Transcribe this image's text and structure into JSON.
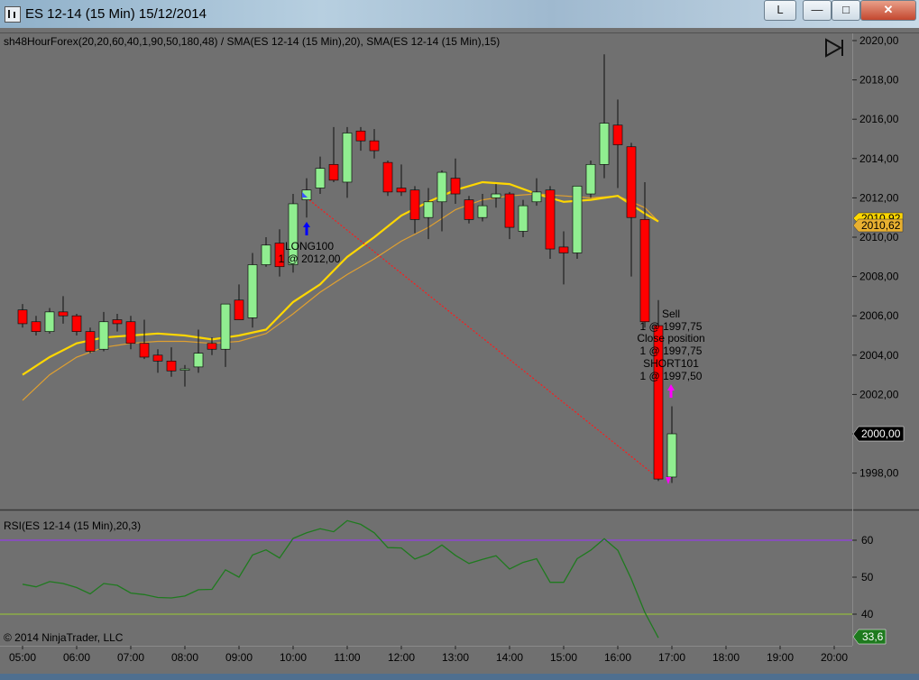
{
  "window": {
    "title": "ES 12-14 (15 Min)  15/12/2014",
    "buttons": {
      "account": "L",
      "minimize": "—",
      "maximize": "□",
      "close": "✕"
    }
  },
  "indicator_header": "sh48HourForex(20,20,60,40,1,90,50,180,48) / SMA(ES 12-14 (15 Min),20), SMA(ES 12-14 (15 Min),15)",
  "price_labels": {
    "current_price": "2000,00",
    "sma_a": "2010,92",
    "sma_b": "2010,62"
  },
  "annotations": {
    "long_entry": [
      "LONG100",
      "1 @ 2012,00"
    ],
    "short_exit": [
      "Sell",
      "1 @ 1997,75",
      "Close position",
      "1 @ 1997,75",
      "SHORT101",
      "1 @ 1997,50"
    ]
  },
  "rsi_header": "RSI(ES 12-14 (15 Min),20,3)",
  "rsi_current": "33,6",
  "copyright": "© 2014 NinjaTrader, LLC",
  "colors": {
    "panel": "#707070",
    "up_candle": "#90ee90",
    "down_candle": "#ff0000",
    "sma20": "#ffd700",
    "sma15": "#e0a030",
    "rsi_line": "#1f7a1f",
    "rsi_upper": "#9b30ff",
    "rsi_lower": "#9acd32"
  },
  "chart_data": {
    "type": "candlestick",
    "price_axis": {
      "ticks": [
        "2020,00",
        "2018,00",
        "2016,00",
        "2014,00",
        "2012,00",
        "2010,00",
        "2008,00",
        "2006,00",
        "2004,00",
        "2002,00",
        "2000,00",
        "1998,00"
      ],
      "range": [
        1996.5,
        2020.5
      ]
    },
    "rsi_axis": {
      "ticks": [
        "60",
        "50",
        "40"
      ],
      "range": [
        30,
        66
      ]
    },
    "time_axis": [
      "05:00",
      "06:00",
      "07:00",
      "08:00",
      "09:00",
      "10:00",
      "11:00",
      "12:00",
      "13:00",
      "14:00",
      "15:00",
      "16:00",
      "17:00",
      "18:00",
      "19:00",
      "20:00"
    ],
    "candles": [
      {
        "t": 5.0,
        "o": 2006.3,
        "h": 2006.6,
        "l": 2005.4,
        "c": 2005.6
      },
      {
        "t": 5.25,
        "o": 2005.7,
        "h": 2006.0,
        "l": 2005.0,
        "c": 2005.2
      },
      {
        "t": 5.5,
        "o": 2005.2,
        "h": 2006.4,
        "l": 2005.1,
        "c": 2006.2
      },
      {
        "t": 5.75,
        "o": 2006.2,
        "h": 2007.0,
        "l": 2005.6,
        "c": 2006.0
      },
      {
        "t": 6.0,
        "o": 2006.0,
        "h": 2006.1,
        "l": 2005.0,
        "c": 2005.2
      },
      {
        "t": 6.25,
        "o": 2005.2,
        "h": 2005.4,
        "l": 2004.1,
        "c": 2004.2
      },
      {
        "t": 6.5,
        "o": 2004.3,
        "h": 2006.2,
        "l": 2004.2,
        "c": 2005.7
      },
      {
        "t": 6.75,
        "o": 2005.8,
        "h": 2006.1,
        "l": 2005.2,
        "c": 2005.6
      },
      {
        "t": 7.0,
        "o": 2005.7,
        "h": 2006.0,
        "l": 2004.3,
        "c": 2004.6
      },
      {
        "t": 7.25,
        "o": 2004.6,
        "h": 2005.8,
        "l": 2003.8,
        "c": 2003.9
      },
      {
        "t": 7.5,
        "o": 2004.0,
        "h": 2004.3,
        "l": 2003.1,
        "c": 2003.7
      },
      {
        "t": 7.75,
        "o": 2003.7,
        "h": 2004.4,
        "l": 2002.9,
        "c": 2003.2
      },
      {
        "t": 8.0,
        "o": 2003.3,
        "h": 2003.5,
        "l": 2002.4,
        "c": 2003.3
      },
      {
        "t": 8.25,
        "o": 2003.4,
        "h": 2005.3,
        "l": 2003.1,
        "c": 2004.1
      },
      {
        "t": 8.5,
        "o": 2004.6,
        "h": 2004.9,
        "l": 2004.0,
        "c": 2004.3
      },
      {
        "t": 8.75,
        "o": 2004.3,
        "h": 2006.6,
        "l": 2003.4,
        "c": 2006.6
      },
      {
        "t": 9.0,
        "o": 2006.8,
        "h": 2007.6,
        "l": 2006.0,
        "c": 2005.8
      },
      {
        "t": 9.25,
        "o": 2005.9,
        "h": 2009.2,
        "l": 2005.4,
        "c": 2008.6
      },
      {
        "t": 9.5,
        "o": 2008.6,
        "h": 2010.0,
        "l": 2008.5,
        "c": 2009.6
      },
      {
        "t": 9.75,
        "o": 2009.7,
        "h": 2010.4,
        "l": 2008.0,
        "c": 2008.5
      },
      {
        "t": 10.0,
        "o": 2008.6,
        "h": 2012.2,
        "l": 2008.2,
        "c": 2011.7
      },
      {
        "t": 10.25,
        "o": 2011.9,
        "h": 2013.0,
        "l": 2011.0,
        "c": 2012.4
      },
      {
        "t": 10.5,
        "o": 2012.5,
        "h": 2014.1,
        "l": 2012.2,
        "c": 2013.5
      },
      {
        "t": 10.75,
        "o": 2013.7,
        "h": 2015.6,
        "l": 2012.8,
        "c": 2012.9
      },
      {
        "t": 11.0,
        "o": 2012.8,
        "h": 2015.6,
        "l": 2012.0,
        "c": 2015.3
      },
      {
        "t": 11.25,
        "o": 2015.4,
        "h": 2015.6,
        "l": 2014.4,
        "c": 2014.9
      },
      {
        "t": 11.5,
        "o": 2014.9,
        "h": 2015.5,
        "l": 2014.0,
        "c": 2014.4
      },
      {
        "t": 11.75,
        "o": 2013.8,
        "h": 2013.9,
        "l": 2012.1,
        "c": 2012.3
      },
      {
        "t": 12.0,
        "o": 2012.5,
        "h": 2013.7,
        "l": 2012.1,
        "c": 2012.3
      },
      {
        "t": 12.25,
        "o": 2012.4,
        "h": 2012.6,
        "l": 2010.2,
        "c": 2010.9
      },
      {
        "t": 12.5,
        "o": 2011.0,
        "h": 2012.5,
        "l": 2009.9,
        "c": 2011.8
      },
      {
        "t": 12.75,
        "o": 2011.8,
        "h": 2013.4,
        "l": 2010.3,
        "c": 2013.3
      },
      {
        "t": 13.0,
        "o": 2013.0,
        "h": 2014.0,
        "l": 2011.7,
        "c": 2012.2
      },
      {
        "t": 13.25,
        "o": 2011.9,
        "h": 2012.1,
        "l": 2010.7,
        "c": 2010.9
      },
      {
        "t": 13.5,
        "o": 2011.0,
        "h": 2012.2,
        "l": 2010.8,
        "c": 2011.6
      },
      {
        "t": 13.75,
        "o": 2012.0,
        "h": 2012.7,
        "l": 2011.5,
        "c": 2012.2
      },
      {
        "t": 14.0,
        "o": 2012.2,
        "h": 2012.3,
        "l": 2009.9,
        "c": 2010.5
      },
      {
        "t": 14.25,
        "o": 2010.3,
        "h": 2011.9,
        "l": 2010.0,
        "c": 2011.6
      },
      {
        "t": 14.5,
        "o": 2011.8,
        "h": 2013.0,
        "l": 2011.6,
        "c": 2012.3
      },
      {
        "t": 14.75,
        "o": 2012.4,
        "h": 2012.6,
        "l": 2008.9,
        "c": 2009.4
      },
      {
        "t": 15.0,
        "o": 2009.5,
        "h": 2010.3,
        "l": 2007.6,
        "c": 2009.2
      },
      {
        "t": 15.25,
        "o": 2009.2,
        "h": 2012.6,
        "l": 2008.9,
        "c": 2012.6
      },
      {
        "t": 15.5,
        "o": 2012.2,
        "h": 2013.9,
        "l": 2012.0,
        "c": 2013.7
      },
      {
        "t": 15.75,
        "o": 2013.7,
        "h": 2019.3,
        "l": 2013.0,
        "c": 2015.8
      },
      {
        "t": 16.0,
        "o": 2015.7,
        "h": 2017.0,
        "l": 2012.5,
        "c": 2014.7
      },
      {
        "t": 16.25,
        "o": 2014.6,
        "h": 2014.8,
        "l": 2008.0,
        "c": 2011.0
      },
      {
        "t": 16.5,
        "o": 2010.9,
        "h": 2012.8,
        "l": 2005.4,
        "c": 2005.7
      },
      {
        "t": 16.75,
        "o": 2005.5,
        "h": 2006.8,
        "l": 1997.6,
        "c": 1997.7
      },
      {
        "t": 17.0,
        "o": 1997.8,
        "h": 2001.4,
        "l": 1997.5,
        "c": 2000.0
      }
    ],
    "sma20": [
      [
        5.0,
        2003.0
      ],
      [
        5.5,
        2003.9
      ],
      [
        6.0,
        2004.6
      ],
      [
        6.5,
        2004.9
      ],
      [
        7.0,
        2005.0
      ],
      [
        7.5,
        2005.1
      ],
      [
        8.0,
        2005.0
      ],
      [
        8.5,
        2004.8
      ],
      [
        9.0,
        2005.0
      ],
      [
        9.5,
        2005.3
      ],
      [
        10.0,
        2006.7
      ],
      [
        10.5,
        2007.6
      ],
      [
        11.0,
        2009.0
      ],
      [
        11.5,
        2010.0
      ],
      [
        12.0,
        2011.1
      ],
      [
        12.5,
        2011.8
      ],
      [
        13.0,
        2012.4
      ],
      [
        13.5,
        2012.8
      ],
      [
        14.0,
        2012.7
      ],
      [
        14.5,
        2012.2
      ],
      [
        15.0,
        2011.8
      ],
      [
        15.5,
        2011.9
      ],
      [
        16.0,
        2012.1
      ],
      [
        16.5,
        2011.2
      ],
      [
        16.75,
        2010.8
      ]
    ],
    "sma15": [
      [
        5.0,
        2001.7
      ],
      [
        5.5,
        2003.0
      ],
      [
        6.0,
        2003.9
      ],
      [
        6.5,
        2004.4
      ],
      [
        7.0,
        2004.6
      ],
      [
        7.5,
        2004.7
      ],
      [
        8.0,
        2004.7
      ],
      [
        8.5,
        2004.6
      ],
      [
        9.0,
        2004.7
      ],
      [
        9.5,
        2005.1
      ],
      [
        10.0,
        2006.1
      ],
      [
        10.5,
        2007.2
      ],
      [
        11.0,
        2008.1
      ],
      [
        11.5,
        2008.9
      ],
      [
        12.0,
        2009.8
      ],
      [
        12.5,
        2010.5
      ],
      [
        13.0,
        2011.4
      ],
      [
        13.5,
        2011.9
      ],
      [
        14.0,
        2012.1
      ],
      [
        14.5,
        2012.2
      ],
      [
        15.0,
        2012.1
      ],
      [
        15.5,
        2012.0
      ],
      [
        16.0,
        2012.1
      ],
      [
        16.5,
        2011.5
      ],
      [
        16.75,
        2010.8
      ]
    ],
    "rsi": [
      [
        5.0,
        48.1
      ],
      [
        5.25,
        47.4
      ],
      [
        5.5,
        48.8
      ],
      [
        5.75,
        48.3
      ],
      [
        6.0,
        47.2
      ],
      [
        6.25,
        45.5
      ],
      [
        6.5,
        48.3
      ],
      [
        6.75,
        47.8
      ],
      [
        7.0,
        45.7
      ],
      [
        7.25,
        45.3
      ],
      [
        7.5,
        44.5
      ],
      [
        7.75,
        44.4
      ],
      [
        8.0,
        44.9
      ],
      [
        8.25,
        46.6
      ],
      [
        8.5,
        46.7
      ],
      [
        8.75,
        52.0
      ],
      [
        9.0,
        50.0
      ],
      [
        9.25,
        56.0
      ],
      [
        9.5,
        57.4
      ],
      [
        9.75,
        55.2
      ],
      [
        10.0,
        60.5
      ],
      [
        10.25,
        62.0
      ],
      [
        10.5,
        63.1
      ],
      [
        10.75,
        62.3
      ],
      [
        11.0,
        65.3
      ],
      [
        11.25,
        64.3
      ],
      [
        11.5,
        62.0
      ],
      [
        11.75,
        58.0
      ],
      [
        12.0,
        57.9
      ],
      [
        12.25,
        54.9
      ],
      [
        12.5,
        56.3
      ],
      [
        12.75,
        58.7
      ],
      [
        13.0,
        55.9
      ],
      [
        13.25,
        53.7
      ],
      [
        13.5,
        54.8
      ],
      [
        13.75,
        55.8
      ],
      [
        14.0,
        52.2
      ],
      [
        14.25,
        54.0
      ],
      [
        14.5,
        55.0
      ],
      [
        14.75,
        48.6
      ],
      [
        15.0,
        48.6
      ],
      [
        15.25,
        55.0
      ],
      [
        15.5,
        57.3
      ],
      [
        15.75,
        60.4
      ],
      [
        16.0,
        57.3
      ],
      [
        16.25,
        49.5
      ],
      [
        16.5,
        40.5
      ],
      [
        16.75,
        33.6
      ]
    ],
    "rsi_levels": [
      60,
      40
    ],
    "trade_line": {
      "from": [
        10.25,
        2012.0
      ],
      "to": [
        16.75,
        1997.75
      ]
    }
  }
}
